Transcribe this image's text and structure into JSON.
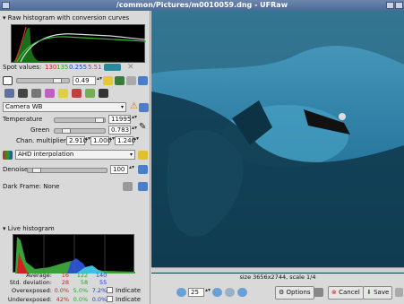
{
  "window": {
    "title": "/common/Pictures/m0010059.dng - UFRaw"
  },
  "raw_histogram": {
    "header": "Raw histogram with conversion curves"
  },
  "spot_values": {
    "label": "Spot values:",
    "r": "130",
    "g": "135",
    "v": "0.255",
    "lum": "5.51",
    "swatch_color": "#2a8a9a"
  },
  "exposure": {
    "value": "0.49"
  },
  "white_balance": {
    "preset": "Camera WB",
    "temperature_label": "Temperature",
    "temperature": "11995",
    "green_label": "Green",
    "green": "0.783",
    "multipliers_label": "Chan. multipliers",
    "mult_r": "2.910",
    "mult_g": "1.000",
    "mult_b": "1.240"
  },
  "interpolation": {
    "value": "AHD interpolation"
  },
  "denoise": {
    "label": "Denoise",
    "value": "100"
  },
  "dark_frame": {
    "label": "Dark Frame: None"
  },
  "live_histogram": {
    "header": "Live histogram"
  },
  "stats": {
    "average_label": "Average:",
    "average": [
      "16",
      "122",
      "140"
    ],
    "stddev_label": "Std. deviation:",
    "stddev": [
      "28",
      "58",
      "55"
    ],
    "over_label": "Overexposed:",
    "over": [
      "0.0%",
      "5.0%",
      "7.2%"
    ],
    "under_label": "Underexposed:",
    "under": [
      "42%",
      "0.0%",
      "0.0%"
    ],
    "indicate_label": "Indicate"
  },
  "image": {
    "size_text": "size 3656x2744, scale 1/4"
  },
  "toolbar": {
    "zoom": "25",
    "options_label": "Options",
    "cancel_label": "Cancel",
    "save_label": "Save"
  },
  "colors": {
    "red": "#d62020",
    "green": "#2aa02a",
    "blue": "#2040d0",
    "title_bar": "#4c6a96"
  }
}
